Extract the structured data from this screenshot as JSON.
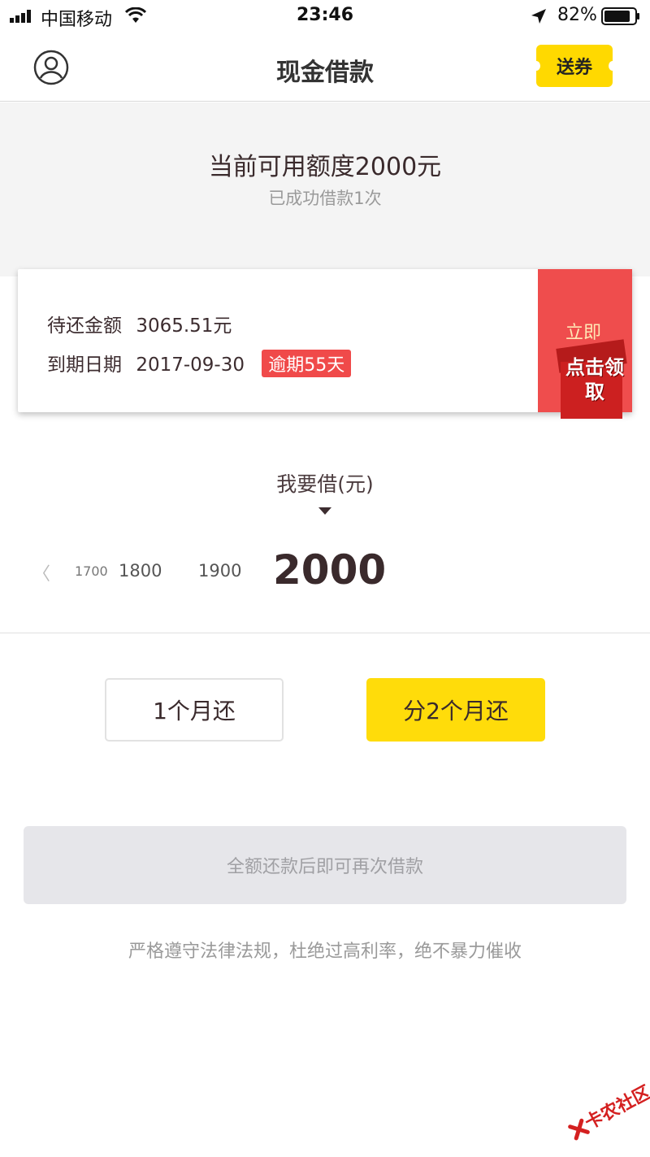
{
  "status_bar": {
    "carrier": "中国移动",
    "time": "23:46",
    "battery": "82%"
  },
  "nav": {
    "title": "现金借款",
    "coupon_label": "送券"
  },
  "summary": {
    "credit_line": "当前可用额度2000元",
    "borrow_count": "已成功借款1次"
  },
  "repayment": {
    "amount_label": "待还金额",
    "amount_value": "3065.51元",
    "due_label": "到期日期",
    "due_value": "2017-09-30",
    "overdue_badge": "逾期55天",
    "promo_top": "立即",
    "promo_gift": "点击领取"
  },
  "picker": {
    "label": "我要借(元)",
    "prev_symbol": "〈",
    "ticks": [
      "1700",
      "1800",
      "1900"
    ],
    "selected": "2000"
  },
  "terms": {
    "option_1": "1个月还",
    "option_2": "分2个月还",
    "selected": "分2个月还"
  },
  "loan_button": "全额还款后即可再次借款",
  "footer_note": "严格遵守法律法规，杜绝过高利率，绝不暴力催收",
  "watermark": "卡农社区",
  "colors": {
    "accent_yellow": "#ffdc0a",
    "overdue_red": "#f04a4a",
    "text_dark": "#3a2a2c"
  }
}
